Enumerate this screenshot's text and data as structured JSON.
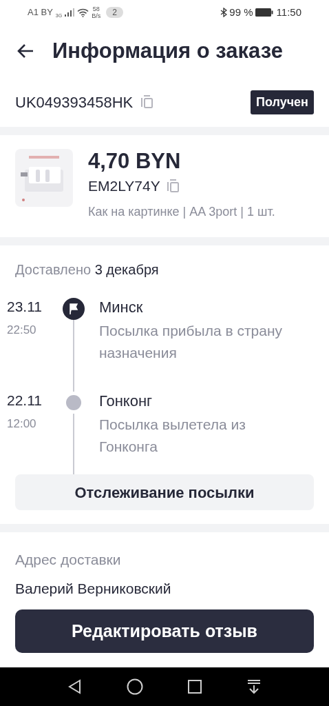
{
  "status_bar": {
    "carrier": "A1 BY",
    "network": "3G",
    "speed_value": "58",
    "speed_unit": "B/s",
    "notifications": "2",
    "battery": "99 %",
    "time": "11:50"
  },
  "header": {
    "title": "Информация о заказе"
  },
  "tracking": {
    "number": "UK049393458HK",
    "status": "Получен"
  },
  "product": {
    "price": "4,70 BYN",
    "code": "EM2LY74Y",
    "options": "Как на картинке | AA 3port | 1 шт."
  },
  "delivery": {
    "label": "Доставлено",
    "date": "3 декабря"
  },
  "timeline": [
    {
      "date": "23.11",
      "time": "22:50",
      "city": "Минск",
      "description": "Посылка прибыла в страну назначения",
      "kind": "flag"
    },
    {
      "date": "22.11",
      "time": "12:00",
      "city": "Гонконг",
      "description": "Посылка вылетела из Гонконга",
      "kind": "dot"
    }
  ],
  "track_button": "Отслеживание посылки",
  "address": {
    "label": "Адрес доставки",
    "name": "Валерий Верниковский"
  },
  "review_button": "Редактировать отзыв"
}
